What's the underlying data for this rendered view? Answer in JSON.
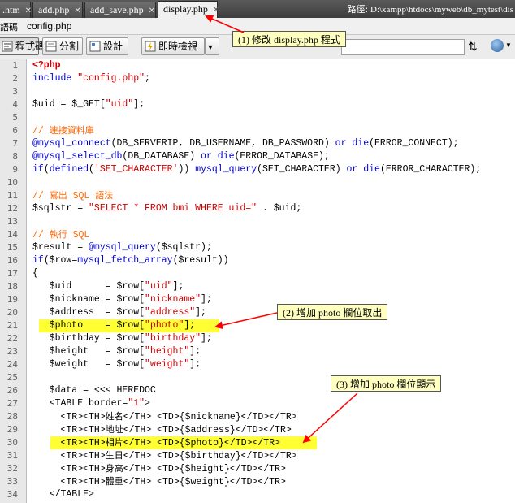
{
  "tabs": [
    {
      "label": ".htm",
      "active": false
    },
    {
      "label": "add.php",
      "active": false
    },
    {
      "label": "add_save.php",
      "active": false
    },
    {
      "label": "display.php",
      "active": true
    }
  ],
  "path": {
    "label": "路徑:",
    "value": "D:\\xampp\\htdocs\\myweb\\db_mytest\\dis"
  },
  "file_row": {
    "label": "語碼",
    "filename": "config.php"
  },
  "toolbar": {
    "code_label": "程式碼",
    "split_label": "分割",
    "design_label": "設計",
    "live_label": "即時檢視"
  },
  "editor": {
    "line_numbers": [
      "1",
      "2",
      "3",
      "4",
      "5",
      "6",
      "7",
      "8",
      "9",
      "10",
      "11",
      "12",
      "13",
      "14",
      "15",
      "16",
      "17",
      "18",
      "19",
      "20",
      "21",
      "22",
      "23",
      "24",
      "25",
      "26",
      "27",
      "28",
      "29",
      "30",
      "31",
      "32",
      "33",
      "34"
    ],
    "lines": [
      "<?php",
      "include \"config.php\";",
      "",
      "$uid = $_GET[\"uid\"];",
      "",
      "// 連接資料庫",
      "@mysql_connect(DB_SERVERIP, DB_USERNAME, DB_PASSWORD) or die(ERROR_CONNECT);",
      "@mysql_select_db(DB_DATABASE) or die(ERROR_DATABASE);",
      "if(defined('SET_CHARACTER')) mysql_query(SET_CHARACTER) or die(ERROR_CHARACTER);",
      "",
      "// 寫出 SQL 語法",
      "$sqlstr = \"SELECT * FROM bmi WHERE uid=\" . $uid;",
      "",
      "// 執行 SQL",
      "$result = @mysql_query($sqlstr);",
      "if($row=mysql_fetch_array($result))",
      "{",
      "   $uid      = $row[\"uid\"];",
      "   $nickname = $row[\"nickname\"];",
      "   $address  = $row[\"address\"];",
      "   $photo    = $row[\"photo\"];",
      "   $birthday = $row[\"birthday\"];",
      "   $height   = $row[\"height\"];",
      "   $weight   = $row[\"weight\"];",
      "",
      "   $data = <<< HEREDOC",
      "   <TABLE border=\"1\">",
      "     <TR><TH>姓名</TH> <TD>{$nickname}</TD></TR>",
      "     <TR><TH>地址</TH> <TD>{$address}</TD></TR>",
      "     <TR><TH>相片</TH> <TD>{$photo}</TD></TR>",
      "     <TR><TH>生日</TH> <TD>{$birthday}</TD></TR>",
      "     <TR><TH>身高</TH> <TD>{$height}</TD></TR>",
      "     <TR><TH>體重</TH> <TD>{$weight}</TD></TR>",
      "   </TABLE>"
    ]
  },
  "callouts": [
    "(1) 修改 display.php 程式",
    "(2) 增加 photo 欄位取出",
    "(3) 增加 photo 欄位顯示"
  ],
  "colors": {
    "highlight": "#ffff33",
    "keyword": "#0000cc",
    "string": "#cc0000",
    "comment": "#ff6600",
    "arrow": "#ff0000"
  }
}
